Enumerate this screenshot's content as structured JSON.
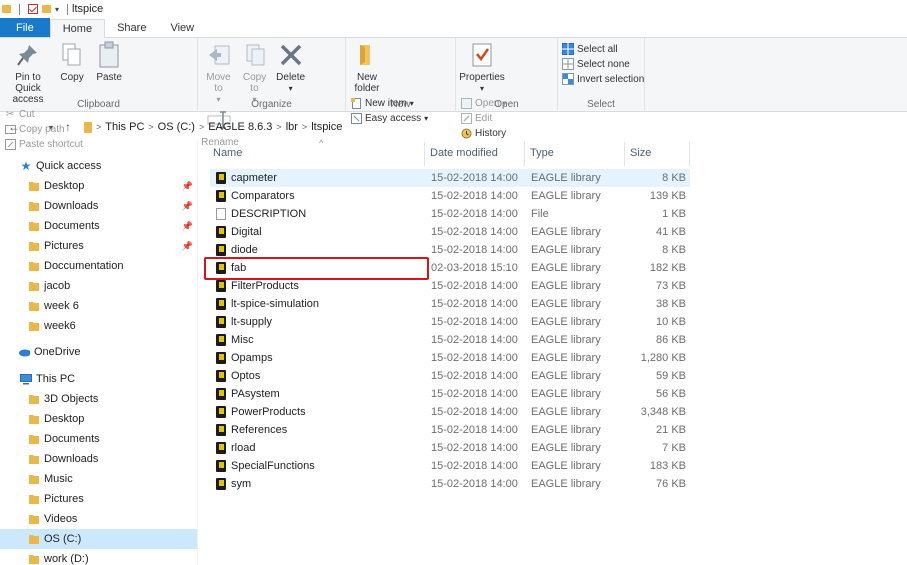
{
  "title_bar": {
    "title": "ltspice"
  },
  "ribbon_tabs": [
    "File",
    "Home",
    "Share",
    "View"
  ],
  "ribbon": {
    "clipboard": {
      "label": "Clipboard",
      "pin": "Pin to Quick access",
      "copy": "Copy",
      "paste": "Paste",
      "cut": "Cut",
      "copy_path": "Copy path",
      "paste_shortcut": "Paste shortcut"
    },
    "organize": {
      "label": "Organize",
      "move_to": "Move to",
      "copy_to": "Copy to",
      "delete": "Delete",
      "rename": "Rename"
    },
    "new": {
      "label": "New",
      "new_folder": "New folder",
      "new_item": "New item",
      "easy_access": "Easy access"
    },
    "open": {
      "label": "Open",
      "properties": "Properties",
      "open": "Open",
      "edit": "Edit",
      "history": "History"
    },
    "select": {
      "label": "Select",
      "select_all": "Select all",
      "select_none": "Select none",
      "invert": "Invert selection"
    }
  },
  "breadcrumbs": [
    "This PC",
    "OS (C:)",
    "EAGLE 8.6.3",
    "lbr",
    "ltspice"
  ],
  "nav": {
    "quick_access": "Quick access",
    "quick_items": [
      {
        "label": "Desktop",
        "pinned": true
      },
      {
        "label": "Downloads",
        "pinned": true
      },
      {
        "label": "Documents",
        "pinned": true
      },
      {
        "label": "Pictures",
        "pinned": true
      },
      {
        "label": "Doccumentation",
        "pinned": false
      },
      {
        "label": "jacob",
        "pinned": false
      },
      {
        "label": "week 6",
        "pinned": false
      },
      {
        "label": "week6",
        "pinned": false
      }
    ],
    "onedrive": "OneDrive",
    "this_pc": "This PC",
    "pc_items": [
      "3D Objects",
      "Desktop",
      "Documents",
      "Downloads",
      "Music",
      "Pictures",
      "Videos",
      "OS (C:)",
      "work (D:)"
    ],
    "selected": "OS (C:)"
  },
  "columns": {
    "name": "Name",
    "date": "Date modified",
    "type": "Type",
    "size": "Size"
  },
  "files": [
    {
      "name": "capmeter",
      "date": "15-02-2018 14:00",
      "type": "EAGLE library",
      "size": "8 KB",
      "icon": "eagle-lib-icon"
    },
    {
      "name": "Comparators",
      "date": "15-02-2018 14:00",
      "type": "EAGLE library",
      "size": "139 KB",
      "icon": "eagle-lib-icon"
    },
    {
      "name": "DESCRIPTION",
      "date": "15-02-2018 14:00",
      "type": "File",
      "size": "1 KB",
      "icon": "file-icon"
    },
    {
      "name": "Digital",
      "date": "15-02-2018 14:00",
      "type": "EAGLE library",
      "size": "41 KB",
      "icon": "eagle-lib-icon"
    },
    {
      "name": "diode",
      "date": "15-02-2018 14:00",
      "type": "EAGLE library",
      "size": "8 KB",
      "icon": "eagle-lib-icon"
    },
    {
      "name": "fab",
      "date": "02-03-2018 15:10",
      "type": "EAGLE library",
      "size": "182 KB",
      "icon": "eagle-lib-icon"
    },
    {
      "name": "FilterProducts",
      "date": "15-02-2018 14:00",
      "type": "EAGLE library",
      "size": "73 KB",
      "icon": "eagle-lib-icon"
    },
    {
      "name": "lt-spice-simulation",
      "date": "15-02-2018 14:00",
      "type": "EAGLE library",
      "size": "38 KB",
      "icon": "eagle-lib-icon"
    },
    {
      "name": "lt-supply",
      "date": "15-02-2018 14:00",
      "type": "EAGLE library",
      "size": "10 KB",
      "icon": "eagle-lib-icon"
    },
    {
      "name": "Misc",
      "date": "15-02-2018 14:00",
      "type": "EAGLE library",
      "size": "86 KB",
      "icon": "eagle-lib-icon"
    },
    {
      "name": "Opamps",
      "date": "15-02-2018 14:00",
      "type": "EAGLE library",
      "size": "1,280 KB",
      "icon": "eagle-lib-icon"
    },
    {
      "name": "Optos",
      "date": "15-02-2018 14:00",
      "type": "EAGLE library",
      "size": "59 KB",
      "icon": "eagle-lib-icon"
    },
    {
      "name": "PAsystem",
      "date": "15-02-2018 14:00",
      "type": "EAGLE library",
      "size": "56 KB",
      "icon": "eagle-lib-icon"
    },
    {
      "name": "PowerProducts",
      "date": "15-02-2018 14:00",
      "type": "EAGLE library",
      "size": "3,348 KB",
      "icon": "eagle-lib-icon"
    },
    {
      "name": "References",
      "date": "15-02-2018 14:00",
      "type": "EAGLE library",
      "size": "21 KB",
      "icon": "eagle-lib-icon"
    },
    {
      "name": "rload",
      "date": "15-02-2018 14:00",
      "type": "EAGLE library",
      "size": "7 KB",
      "icon": "eagle-lib-icon"
    },
    {
      "name": "SpecialFunctions",
      "date": "15-02-2018 14:00",
      "type": "EAGLE library",
      "size": "183 KB",
      "icon": "eagle-lib-icon"
    },
    {
      "name": "sym",
      "date": "15-02-2018 14:00",
      "type": "EAGLE library",
      "size": "76 KB",
      "icon": "eagle-lib-icon"
    }
  ],
  "highlighted_row": "capmeter",
  "annotated_row": "fab",
  "colors": {
    "file_tab": "#1979ca",
    "selection": "#cce8ff",
    "hover_row": "#e5f3ff",
    "annotation": "#d2161b",
    "folder": "#e8b94a"
  }
}
